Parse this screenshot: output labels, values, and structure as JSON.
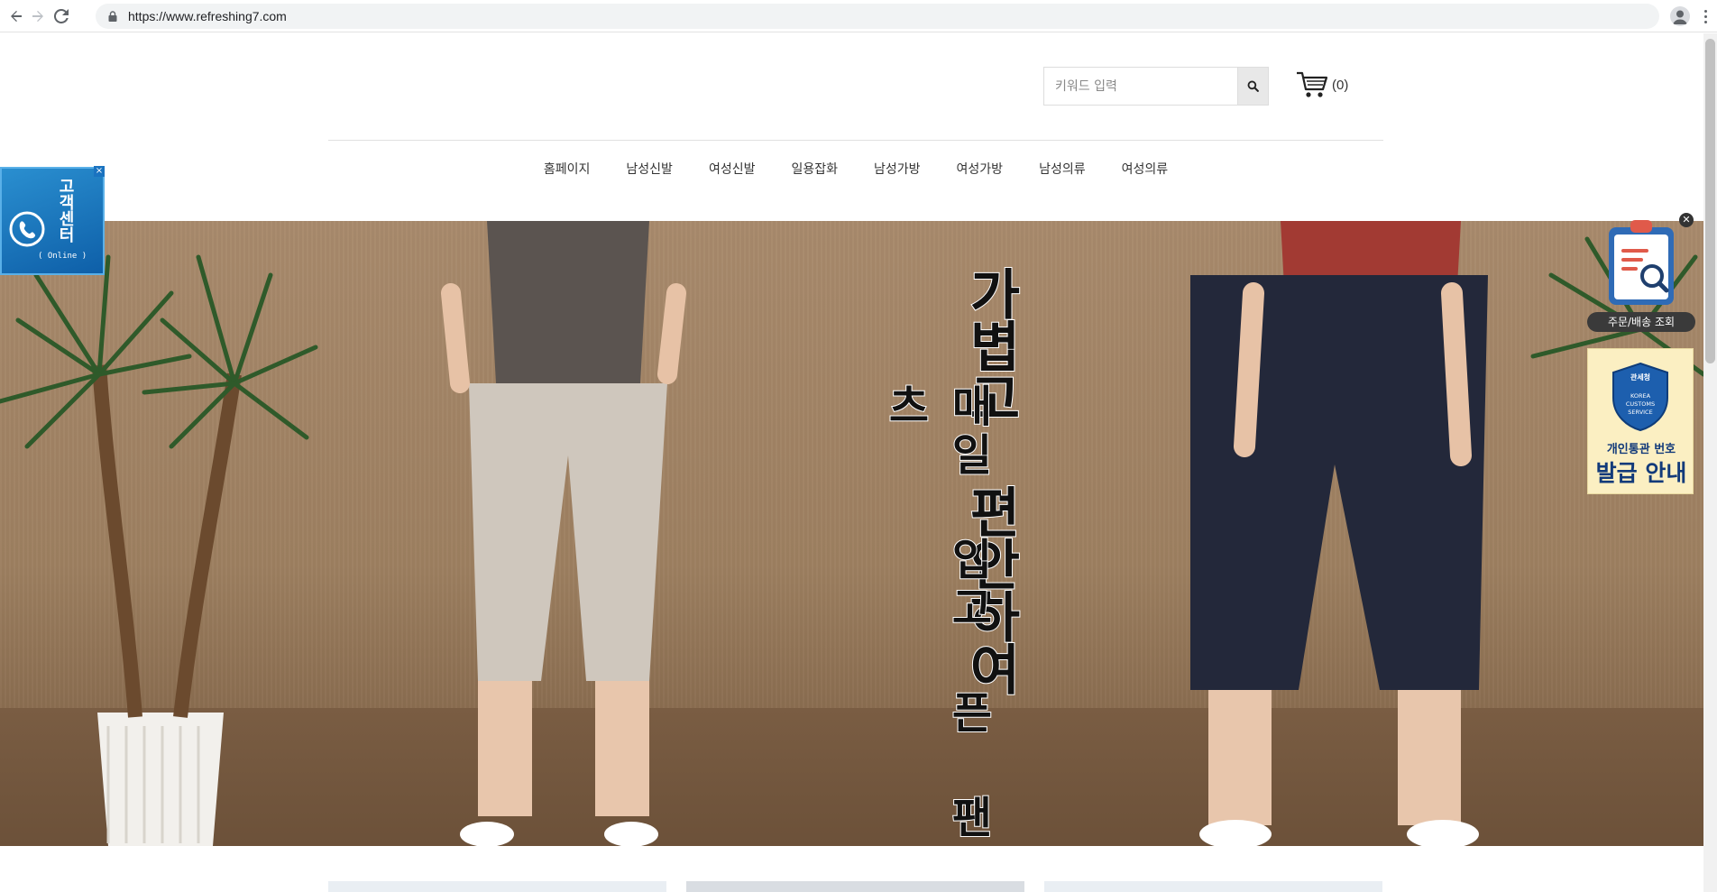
{
  "browser": {
    "url": "https://www.refreshing7.com"
  },
  "header": {
    "search_placeholder": "키워드 입력",
    "cart_count": "(0)"
  },
  "nav": {
    "items": [
      {
        "label": "홈페이지"
      },
      {
        "label": "남성신발"
      },
      {
        "label": "여성신발"
      },
      {
        "label": "일용잡화"
      },
      {
        "label": "남성가방"
      },
      {
        "label": "여성가방"
      },
      {
        "label": "남성의류"
      },
      {
        "label": "여성의류"
      }
    ]
  },
  "banner": {
    "headline": "가볍고 편안하여",
    "subline": "매일 입고 픈 팬츠"
  },
  "widgets": {
    "customer_center": {
      "title": "고객센터",
      "status": "( Online )",
      "close": "×"
    },
    "order_lookup": {
      "label": "주문/배송 조회",
      "close": "✕"
    },
    "customs": {
      "badge_title": "관세청",
      "badge_sub": "KOREA CUSTOMS SERVICE",
      "line1": "개인통관 번호",
      "line2": "발급 안내"
    }
  },
  "colors": {
    "nav_text": "#333333",
    "customs_blue": "#123a7a",
    "cs_blue": "#1a73c0"
  }
}
